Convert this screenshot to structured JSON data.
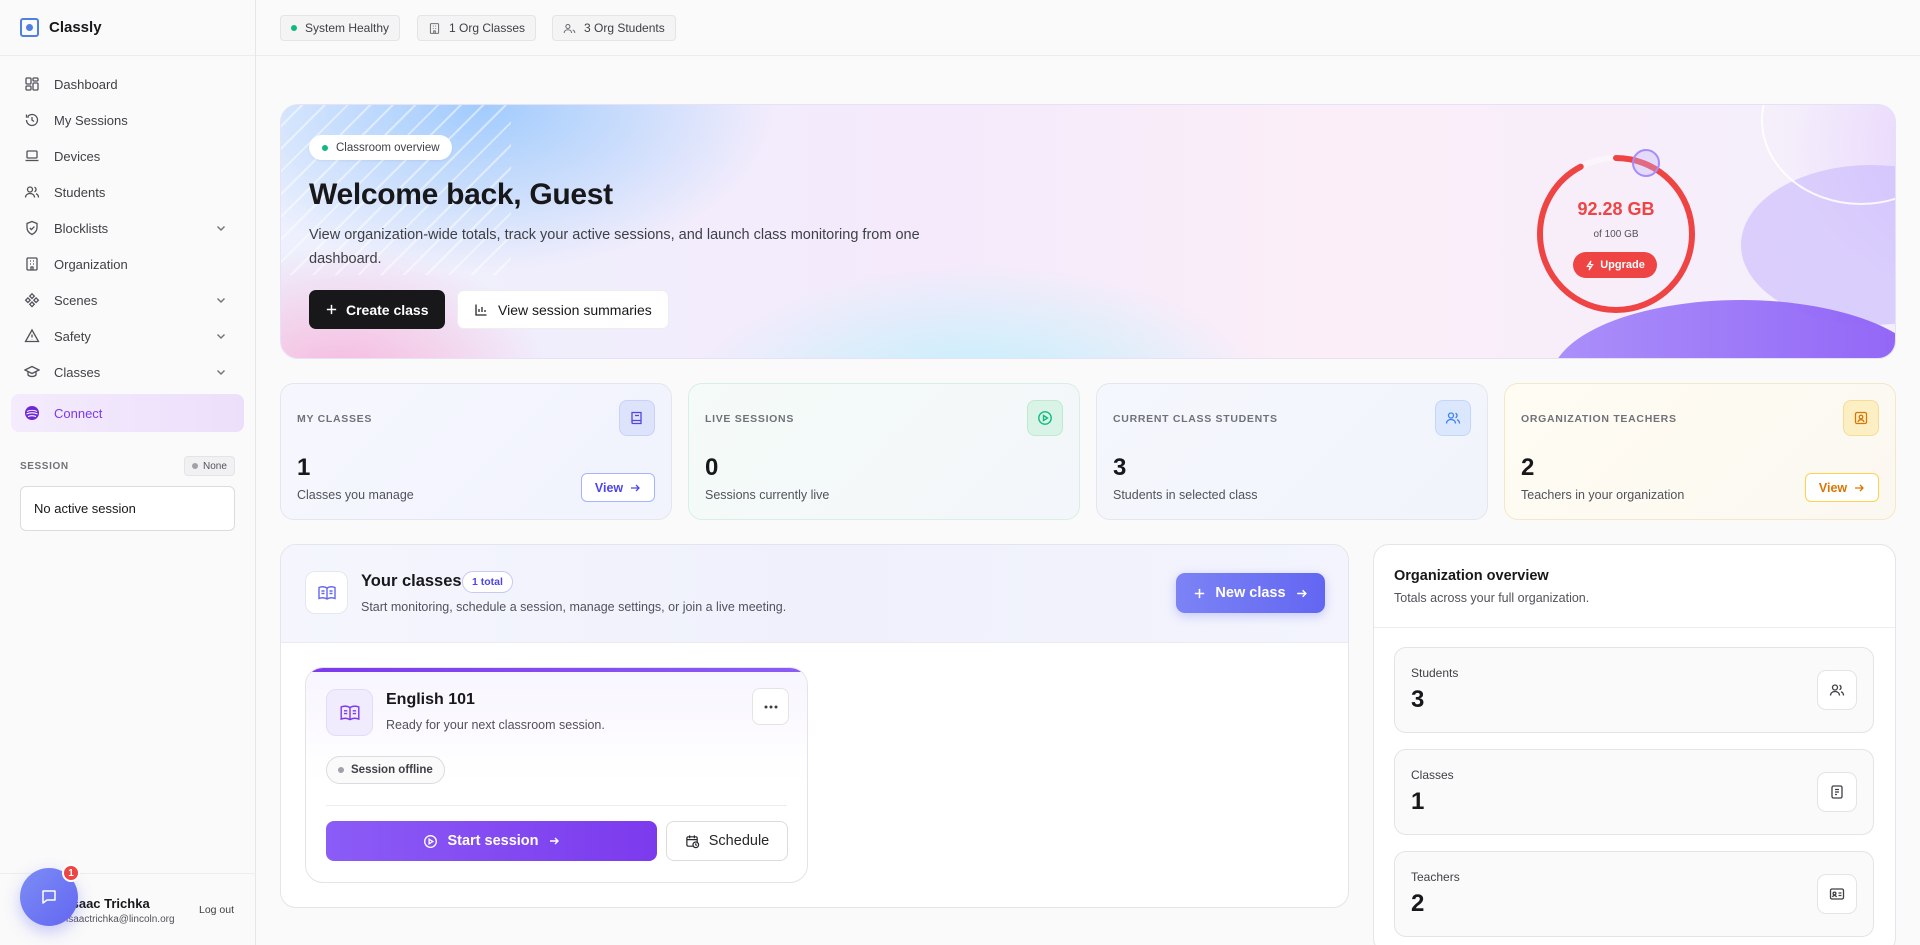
{
  "app": {
    "name": "Classly"
  },
  "sidebar": {
    "items": [
      {
        "label": "Dashboard",
        "icon": "dashboard-icon"
      },
      {
        "label": "My Sessions",
        "icon": "history-icon"
      },
      {
        "label": "Devices",
        "icon": "laptop-icon"
      },
      {
        "label": "Students",
        "icon": "users-icon"
      },
      {
        "label": "Blocklists",
        "icon": "shield-icon",
        "expandable": true
      },
      {
        "label": "Organization",
        "icon": "building-icon"
      },
      {
        "label": "Scenes",
        "icon": "scenes-icon",
        "expandable": true
      },
      {
        "label": "Safety",
        "icon": "warning-icon",
        "expandable": true
      },
      {
        "label": "Classes",
        "icon": "graduation-cap-icon",
        "expandable": true
      },
      {
        "label": "Connect",
        "icon": "connect-icon",
        "active": true
      }
    ],
    "session": {
      "label": "SESSION",
      "status": "None",
      "value": "No active session"
    },
    "user": {
      "name": "Isaac Trichka",
      "email": "isaactrichka@lincoln.org",
      "logout": "Log out"
    },
    "chat": {
      "badge": "1"
    }
  },
  "topbar": {
    "chips": [
      {
        "label": "System Healthy",
        "icon": "status-dot"
      },
      {
        "label": "1 Org Classes",
        "icon": "building-icon"
      },
      {
        "label": "3 Org Students",
        "icon": "users-icon"
      }
    ]
  },
  "hero": {
    "pill": "Classroom overview",
    "title": "Welcome back, Guest",
    "subtitle": "View organization-wide totals, track your active sessions, and launch class monitoring from one dashboard.",
    "create_label": "Create class",
    "summaries_label": "View session summaries",
    "storage": {
      "value": "92.28 GB",
      "of": "of 100 GB",
      "used_fraction": 0.9228,
      "upgrade": "Upgrade",
      "color": "#ef4444"
    }
  },
  "stats": [
    {
      "label": "MY CLASSES",
      "value": "1",
      "desc": "Classes you manage",
      "view": "View",
      "icon": "book-icon",
      "accent": "#4f46e5"
    },
    {
      "label": "LIVE SESSIONS",
      "value": "0",
      "desc": "Sessions currently live",
      "icon": "play-circle-icon",
      "accent": "#10b981"
    },
    {
      "label": "CURRENT CLASS STUDENTS",
      "value": "3",
      "desc": "Students in selected class",
      "icon": "users-icon",
      "accent": "#3b82f6"
    },
    {
      "label": "ORGANIZATION TEACHERS",
      "value": "2",
      "desc": "Teachers in your organization",
      "view": "View",
      "icon": "badge-icon",
      "accent": "#d97706"
    }
  ],
  "classes": {
    "title": "Your classes",
    "count": "1 total",
    "subtitle": "Start monitoring, schedule a session, manage settings, or join a live meeting.",
    "new_class": "New class",
    "cards": [
      {
        "name": "English 101",
        "subtitle": "Ready for your next classroom session.",
        "status": "Session offline",
        "start": "Start session",
        "schedule": "Schedule"
      }
    ]
  },
  "org": {
    "title": "Organization overview",
    "subtitle": "Totals across your full organization.",
    "items": [
      {
        "label": "Students",
        "value": "3",
        "icon": "users-icon"
      },
      {
        "label": "Classes",
        "value": "1",
        "icon": "notebook-icon"
      },
      {
        "label": "Teachers",
        "value": "2",
        "icon": "id-card-icon"
      }
    ]
  }
}
